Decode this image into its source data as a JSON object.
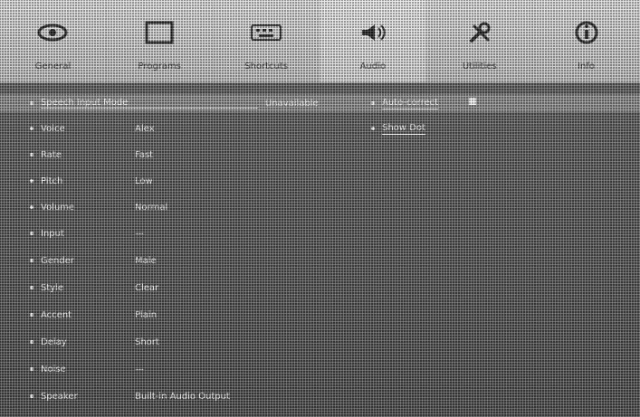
{
  "toolbar": {
    "items": [
      {
        "label": "General",
        "icon": "eye-icon"
      },
      {
        "label": "Programs",
        "icon": "window-icon"
      },
      {
        "label": "Shortcuts",
        "icon": "keyboard-icon"
      },
      {
        "label": "Audio",
        "icon": "speaker-icon"
      },
      {
        "label": "Utilities",
        "icon": "tools-icon"
      },
      {
        "label": "Info",
        "icon": "info-icon"
      }
    ]
  },
  "content": {
    "header": {
      "title": "Speech Input Mode",
      "status": "Unavailable"
    },
    "rows": [
      {
        "name": "Voice",
        "value": "Alex"
      },
      {
        "name": "Rate",
        "value": "Fast"
      },
      {
        "name": "Pitch",
        "value": "Low"
      },
      {
        "name": "Volume",
        "value": "Normal"
      },
      {
        "name": "Input",
        "value": "—"
      },
      {
        "name": "Gender",
        "value": "Male"
      },
      {
        "name": "Style",
        "value": "Clear"
      },
      {
        "name": "Accent",
        "value": "Plain"
      },
      {
        "name": "Delay",
        "value": "Short"
      },
      {
        "name": "Noise",
        "value": "—"
      },
      {
        "name": "Speaker",
        "value": "Built-in Audio Output"
      }
    ],
    "side_items": [
      {
        "label": "Auto-correct"
      },
      {
        "label": "Show Dot"
      }
    ]
  }
}
